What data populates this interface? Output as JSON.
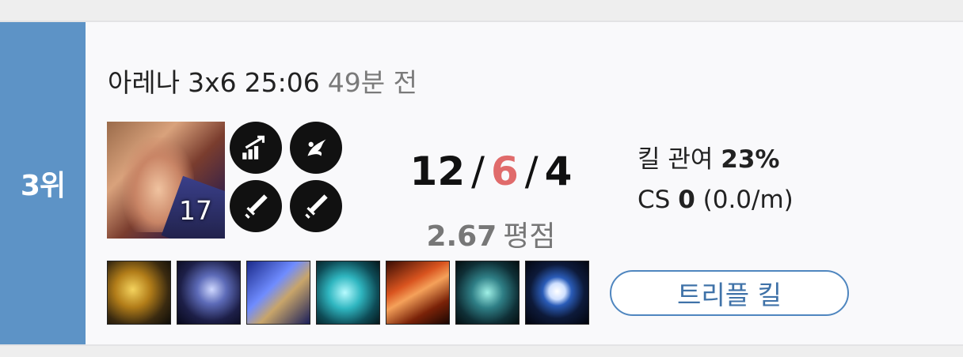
{
  "match": {
    "rank": "3위",
    "mode": "아레나",
    "team_size": "3x6",
    "duration": "25:06",
    "time_ago": "49분 전"
  },
  "champion": {
    "level": "17"
  },
  "spells": [
    {
      "name": "augment-boost-icon"
    },
    {
      "name": "flash-icon"
    },
    {
      "name": "sword-strike-icon"
    },
    {
      "name": "sword-strike-icon"
    }
  ],
  "kda": {
    "kills": "12",
    "deaths": "6",
    "assists": "4",
    "separator": "/",
    "deaths_color": "#e06b6b"
  },
  "rating": {
    "value": "2.67",
    "unit": "평점"
  },
  "stats": {
    "kill_participation_label": "킬 관여",
    "kill_participation_value": "23%",
    "cs_label": "CS",
    "cs_value": "0",
    "cs_per_min": "(0.0/m)"
  },
  "items": [
    {
      "name": "golden-blade-item"
    },
    {
      "name": "dark-wing-item"
    },
    {
      "name": "blue-crossbow-item"
    },
    {
      "name": "teal-katana-item"
    },
    {
      "name": "flame-gauntlet-item"
    },
    {
      "name": "spectral-trident-item"
    },
    {
      "name": "stealth-ward-eye-item"
    }
  ],
  "badge": {
    "label": "트리플 킬"
  },
  "colors": {
    "rank_bar": "#5d93c6",
    "badge_border": "#4f86bf",
    "badge_text": "#3f72a8"
  }
}
